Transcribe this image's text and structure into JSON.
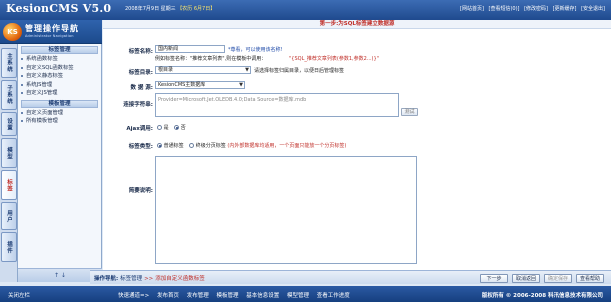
{
  "header": {
    "app_title": "KesionCMS V5.0",
    "date_text": "2008年7月9日 星期三",
    "lunar_text": "【农历 6月7日】",
    "links": [
      "[网站首页]",
      "[查看短信(0)]",
      "[修改密码]",
      "[更新缓存]",
      "[安全退出]"
    ]
  },
  "logo": {
    "badge": "KS",
    "main": "管理操作导航",
    "sub": "Administrator Navigation"
  },
  "vtabs": [
    "主系统",
    "子系统",
    "设置",
    "模型",
    "标签",
    "用户",
    "插件"
  ],
  "sidebar": {
    "sections": [
      {
        "title": "标签管理",
        "items": [
          "系统函数标签",
          "自定义SQL函数标签",
          "自定义静态标签",
          "系统JS管理",
          "自定义JS管理"
        ]
      },
      {
        "title": "模板管理",
        "items": [
          "自定义页面管理",
          "所有模板管理"
        ]
      }
    ],
    "bottom_arrows": "↑ ↓"
  },
  "form": {
    "step_title": "第一步:为SQL标签建立数据源",
    "label_name": "标签名称:",
    "name_value": "国内新闻",
    "name_hint": "*尊看，可以使用该名称!",
    "example_text": "例如标签名称：\"推荐文章列表\",则在模板中调用：",
    "example_call": "\"{SQL_推荐文章列表(参数1,参数2...)}\"",
    "label_dir": "标签目录:",
    "dir_value": "根目录",
    "dir_hint": "请选择标签归属目录，以便日后管理标签",
    "label_datasource": "数 据 源:",
    "datasource_value": "KesionCMS主数据库",
    "label_conn": "连接字符串:",
    "conn_placeholder": "Provider=Microsoft.Jet.OLEDB.4.0;Data Source=数据库.mdb",
    "test_button": "测试",
    "label_ajax": "Ajax调用:",
    "ajax_options": [
      "是",
      "否"
    ],
    "label_type": "标签类型:",
    "type_options": [
      "普通标签",
      "终级分页标签"
    ],
    "type_hint": "(内外部数据库均适用，一个页面只能放一个分页标签)",
    "label_desc": "简要说明:"
  },
  "navbar": {
    "label": "操作导航:",
    "current": "标签管理",
    "arrow": ">>",
    "action": "添加自定义函数标签",
    "buttons": [
      "下一步",
      "取消返回",
      "确定保存",
      "查看帮助"
    ]
  },
  "footer": {
    "left": "关闭左栏",
    "links": [
      "快速通道=>",
      "发布首页",
      "发布管理",
      "模板管理",
      "基本信息设置",
      "模型管理",
      "查看工作进度"
    ],
    "copyright": "版权所有 © 2006-2008  科汛信息技术有限公司"
  }
}
